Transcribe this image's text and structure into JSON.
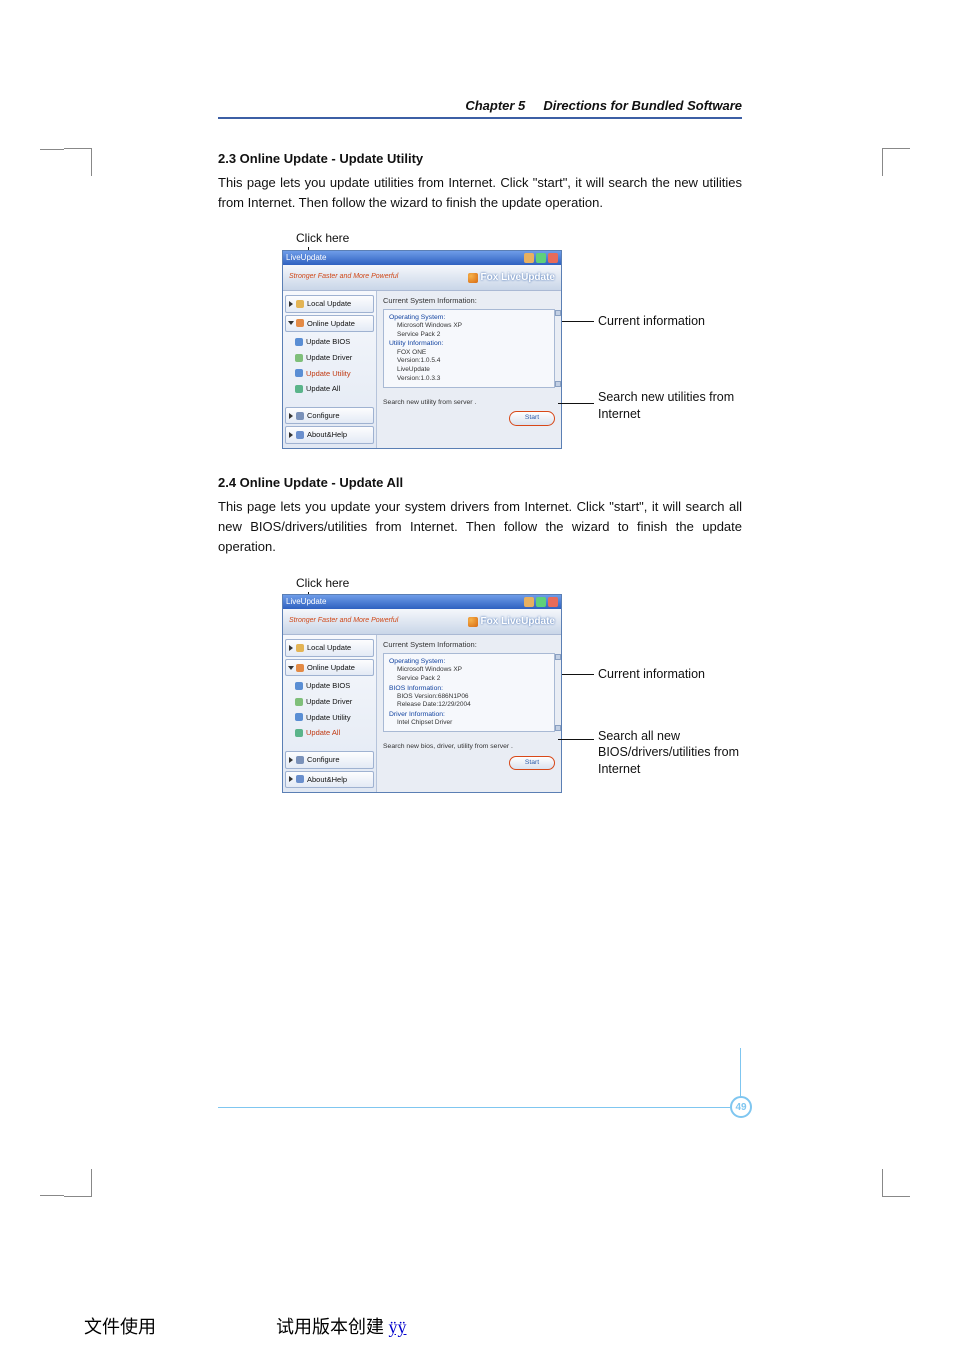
{
  "header": {
    "chapter": "Chapter 5",
    "title": "Directions for Bundled Software"
  },
  "section23": {
    "heading": "2.3 Online Update - Update Utility",
    "body": "This page lets you update utilities from Internet. Click \"start\", it will search the new utilities from Internet. Then follow the wizard to finish the update operation.",
    "click_here": "Click here",
    "callout_current": "Current information",
    "callout_search": "Search new utilities from Internet"
  },
  "section24": {
    "heading": "2.4 Online Update - Update All",
    "body": "This page lets you update your system drivers from Internet. Click \"start\", it will search all new BIOS/drivers/utilities from Internet. Then follow the wizard to finish the update operation.",
    "click_here": "Click here",
    "callout_current": "Current information",
    "callout_search": "Search all new BIOS/drivers/utilities from Internet"
  },
  "app": {
    "title": "LiveUpdate",
    "tagline": "Stronger Faster and More Powerful",
    "brand": "Fox LiveUpdate",
    "sidebar": {
      "local_update": "Local Update",
      "online_update": "Online Update",
      "update_bios": "Update BIOS",
      "update_driver": "Update Driver",
      "update_utility": "Update Utility",
      "update_all": "Update All",
      "configure": "Configure",
      "about_help": "About&Help"
    },
    "panel_utility": {
      "header": "Current System Information:",
      "os_title": "Operating System:",
      "os_line1": "Microsoft Windows XP",
      "os_line2": "Service Pack 2",
      "util_title": "Utility Information:",
      "util_line1": "FOX ONE",
      "util_line2": "Version:1.0.5.4",
      "util_line3": "LiveUpdate",
      "util_line4": "Version:1.0.3.3",
      "search_label": "Search new utility from server .",
      "start": "Start"
    },
    "panel_all": {
      "header": "Current System Information:",
      "os_title": "Operating System:",
      "os_line1": "Microsoft Windows XP",
      "os_line2": "Service Pack 2",
      "bios_title": "BIOS Information:",
      "bios_line1": "BIOS Version:686N1P06",
      "bios_line2": "Release Date:12/29/2004",
      "drv_title": "Driver Information:",
      "drv_line1": "Intel Chipset Driver",
      "search_label": "Search new bios, driver, utility from server .",
      "start": "Start"
    }
  },
  "page_number": "49",
  "footer": {
    "left": "文件使用",
    "mid": "试用版本创建",
    "link": "ÿÿ"
  }
}
